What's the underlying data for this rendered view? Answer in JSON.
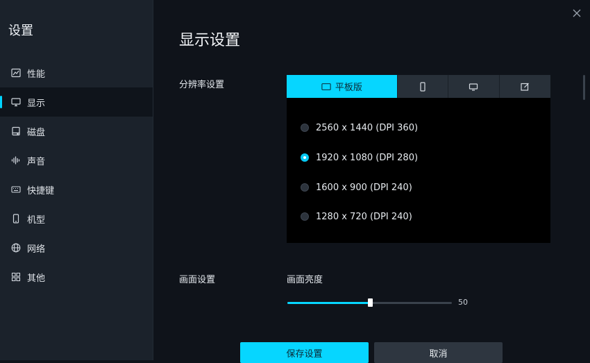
{
  "sidebar": {
    "title": "设置",
    "items": [
      {
        "label": "性能",
        "icon": "performance-chart-icon"
      },
      {
        "label": "显示",
        "icon": "monitor-icon",
        "active": true
      },
      {
        "label": "磁盘",
        "icon": "disk-icon"
      },
      {
        "label": "声音",
        "icon": "sound-wave-icon"
      },
      {
        "label": "快捷键",
        "icon": "keyboard-icon"
      },
      {
        "label": "机型",
        "icon": "phone-icon"
      },
      {
        "label": "网络",
        "icon": "globe-icon"
      },
      {
        "label": "其他",
        "icon": "grid-icon"
      }
    ]
  },
  "main": {
    "title": "显示设置",
    "resolution": {
      "label": "分辨率设置",
      "tabs": [
        {
          "label": "平板版",
          "icon": "tablet-icon",
          "active": true
        },
        {
          "label": "",
          "icon": "phone-icon"
        },
        {
          "label": "",
          "icon": "desktop-icon"
        },
        {
          "label": "",
          "icon": "edit-icon"
        }
      ],
      "options": [
        {
          "label": "2560 x 1440 (DPI 360)",
          "checked": false
        },
        {
          "label": "1920 x 1080 (DPI 280)",
          "checked": true
        },
        {
          "label": "1600 x 900 (DPI 240)",
          "checked": false
        },
        {
          "label": "1280 x 720 (DPI 240)",
          "checked": false
        }
      ]
    },
    "picture": {
      "label": "画面设置",
      "brightness_label": "画面亮度",
      "brightness_value": 50,
      "brightness_value_text": "50"
    },
    "buttons": {
      "save": "保存设置",
      "cancel": "取消"
    }
  },
  "colors": {
    "accent": "#06d6ff",
    "sidebar_bg": "#1b222b",
    "main_bg": "#0f131a"
  }
}
